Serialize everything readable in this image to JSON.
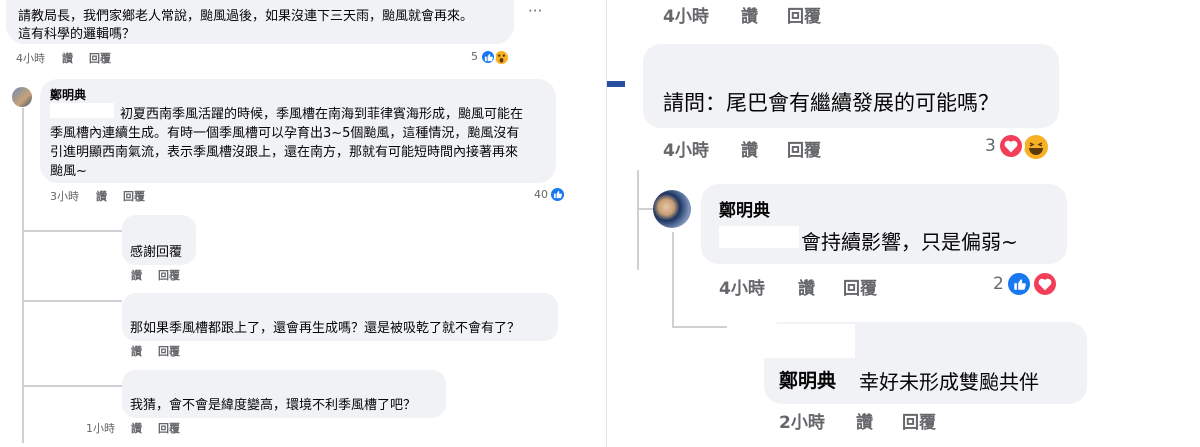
{
  "left": {
    "top_comment": {
      "line1": "請教局長，我們家鄉老人常說，颱風過後，如果沒連下三天雨，颱風就會再來。",
      "line2": "這有科學的邏輯嗎？",
      "more": "···",
      "time": "4小時",
      "like": "讚",
      "reply": "回覆",
      "reaction_count": "5"
    },
    "official_reply": {
      "author": "鄭明典",
      "lines": [
        "初夏西南季風活躍的時候，季風槽在南海到菲律賓海形成，颱風可能在",
        "季風槽內連續生成。有時一個季風槽可以孕育出3~5個颱風，這種情況，颱風沒有",
        "引進明顯西南氣流，表示季風槽沒跟上，還在南方，那就有可能短時間內接著再來",
        "颱風~"
      ],
      "time": "3小時",
      "like": "讚",
      "reply": "回覆",
      "reaction_count": "40"
    },
    "replies": [
      {
        "text": "感謝回覆",
        "like": "讚",
        "reply": "回覆"
      },
      {
        "text": "那如果季風槽都跟上了，還會再生成嗎？還是被吸乾了就不會有了？",
        "like": "讚",
        "reply": "回覆"
      },
      {
        "text": "我猜，會不會是緯度變高，環境不利季風槽了吧？",
        "time": "1小時",
        "like": "讚",
        "reply": "回覆"
      }
    ]
  },
  "right": {
    "top_actions": {
      "time": "4小時",
      "like": "讚",
      "reply": "回覆"
    },
    "question": {
      "text": "請問：尾巴會有繼續發展的可能嗎？",
      "time": "4小時",
      "like": "讚",
      "reply": "回覆",
      "reaction_count": "3"
    },
    "official_reply": {
      "author": "鄭明典",
      "text": "會持續影響，只是偏弱~",
      "time": "4小時",
      "like": "讚",
      "reply": "回覆",
      "reaction_count": "2"
    },
    "nested_reply": {
      "mention": "鄭明典",
      "text": "幸好未形成雙颱共伴",
      "time": "2小時",
      "like": "讚",
      "reply": "回覆"
    }
  },
  "colors": {
    "bubble": "#f0f2f5",
    "meta_text": "#65676b",
    "like_blue": "#1877f2",
    "love_red": "#f33e58",
    "haha_yellow": "#f7b125"
  },
  "icons": [
    "like-reaction-icon",
    "wow-reaction-icon",
    "love-reaction-icon",
    "haha-reaction-icon",
    "more-options-icon"
  ]
}
